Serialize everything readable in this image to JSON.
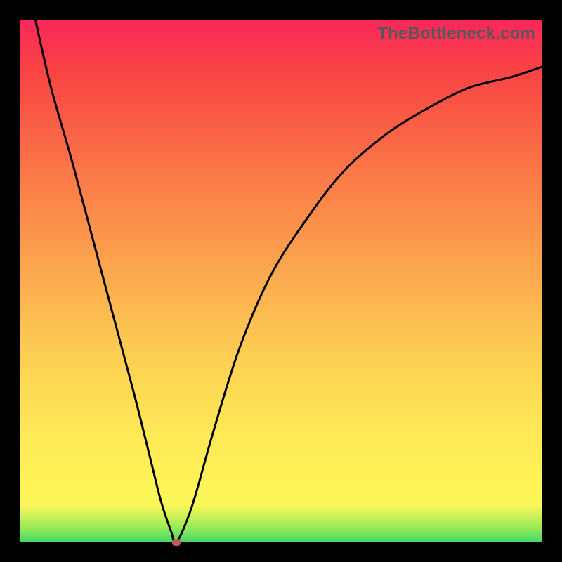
{
  "watermark": "TheBottleneck.com",
  "chart_data": {
    "type": "line",
    "title": "",
    "xlabel": "",
    "ylabel": "",
    "xlim": [
      0,
      100
    ],
    "ylim": [
      0,
      100
    ],
    "grid": false,
    "legend": false,
    "series": [
      {
        "name": "curve",
        "color": "#000000",
        "x": [
          3,
          6,
          10,
          14,
          18,
          22,
          25,
          27,
          29,
          30,
          33,
          37,
          42,
          48,
          55,
          62,
          70,
          78,
          86,
          94,
          100
        ],
        "y": [
          100,
          87,
          73,
          58,
          43,
          28,
          16,
          8,
          2,
          0,
          7,
          21,
          37,
          51,
          62,
          71,
          78,
          83,
          87,
          89,
          91
        ]
      }
    ],
    "marker": {
      "x": 30,
      "y": 0,
      "color": "#BB5D53"
    },
    "background_gradient": {
      "top": "#F9275B",
      "mid_upper": "#FB934B",
      "mid": "#FEF557",
      "bottom": "#41D968"
    }
  }
}
